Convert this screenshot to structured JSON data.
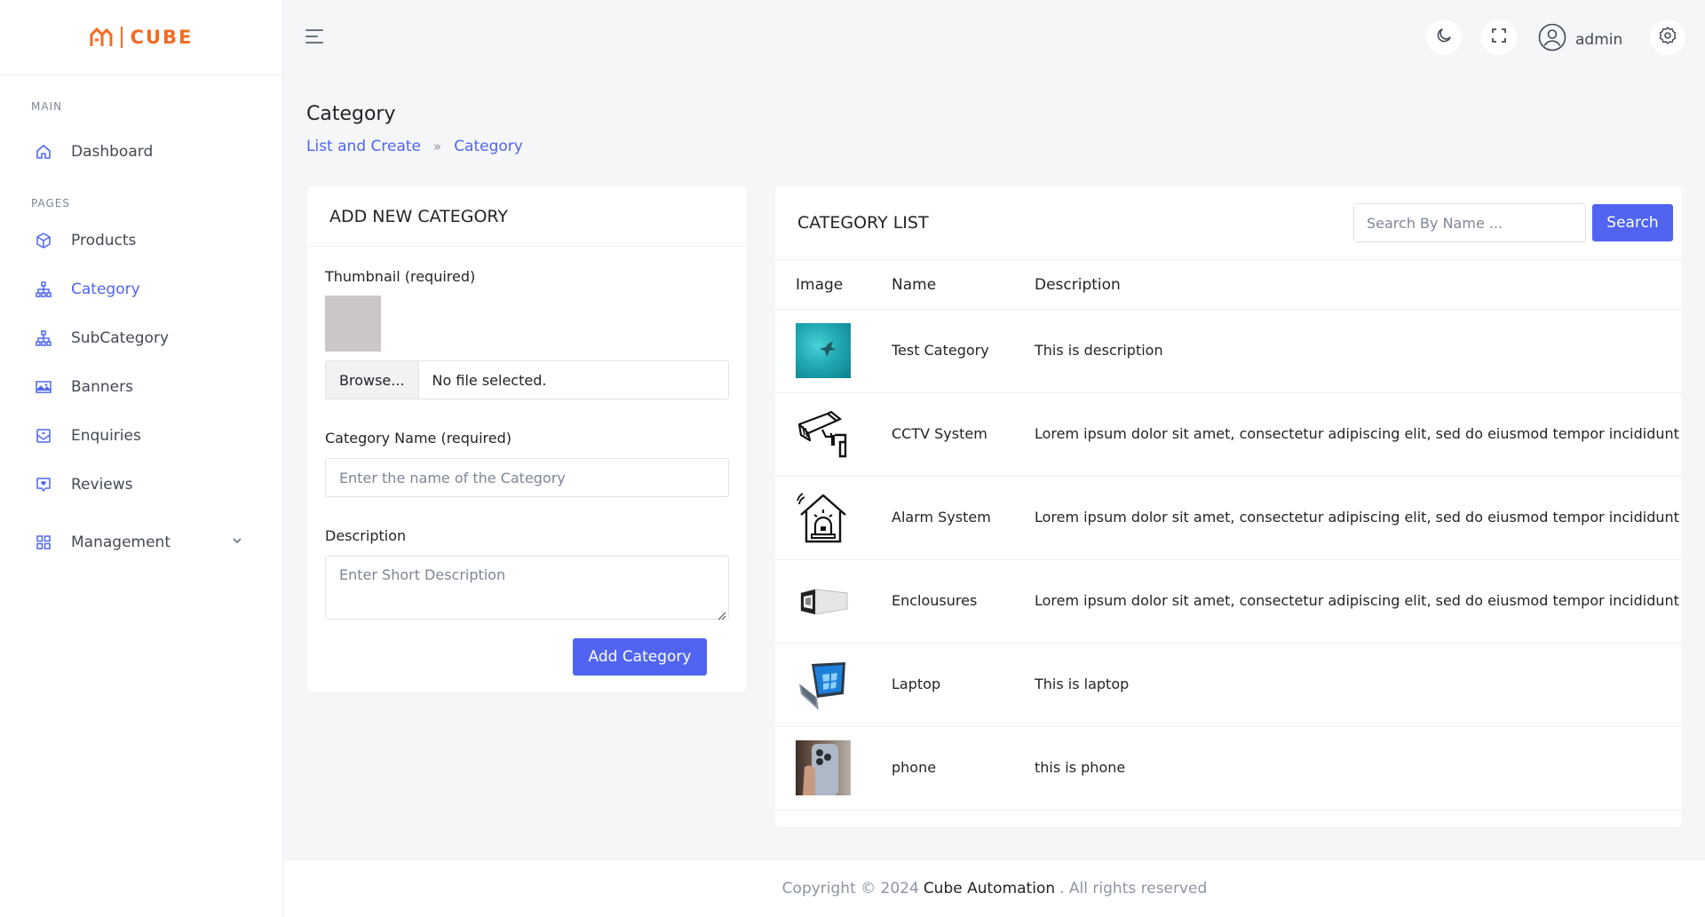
{
  "brand": {
    "name": "CUBE",
    "color": "#f26b21"
  },
  "sidebar": {
    "section_main": "MAIN",
    "section_pages": "PAGES",
    "items": [
      {
        "label": "Dashboard",
        "icon": "home-icon"
      },
      {
        "label": "Products",
        "icon": "box-icon"
      },
      {
        "label": "Category",
        "icon": "sitemap-icon",
        "active": true
      },
      {
        "label": "SubCategory",
        "icon": "sitemap-icon"
      },
      {
        "label": "Banners",
        "icon": "image-icon"
      },
      {
        "label": "Enquiries",
        "icon": "mail-icon"
      },
      {
        "label": "Reviews",
        "icon": "heart-message-icon"
      },
      {
        "label": "Management",
        "icon": "grid-icon"
      }
    ]
  },
  "topbar": {
    "username": "admin"
  },
  "page": {
    "title": "Category",
    "breadcrumb": [
      "List and Create",
      "Category"
    ]
  },
  "add_form": {
    "heading": "ADD NEW CATEGORY",
    "thumbnail_label": "Thumbnail (required)",
    "browse_label": "Browse...",
    "file_status": "No file selected.",
    "name_label": "Category Name (required)",
    "name_placeholder": "Enter the name of the Category",
    "description_label": "Description",
    "description_placeholder": "Enter Short Description",
    "submit_label": "Add Category"
  },
  "list": {
    "heading": "CATEGORY LIST",
    "search_placeholder": "Search By Name ...",
    "search_label": "Search",
    "columns": [
      "Image",
      "Name",
      "Description"
    ],
    "rows": [
      {
        "name": "Test Category",
        "description": "This is description",
        "image": "water-photo"
      },
      {
        "name": "CCTV System",
        "description": "Lorem ipsum dolor sit amet, consectetur adipiscing elit, sed do eiusmod tempor incididunt ut labore et dolore magna aliqua.",
        "image": "cctv-camera-icon"
      },
      {
        "name": "Alarm System",
        "description": "Lorem ipsum dolor sit amet, consectetur adipiscing elit, sed do eiusmod tempor incididunt ut labore et dolore magna aliqua.",
        "image": "alarm-house-icon"
      },
      {
        "name": "Enclousures",
        "description": "Lorem ipsum dolor sit amet, consectetur adipiscing elit, sed do eiusmod tempor incididunt ut labore et dolore magna aliqua.",
        "image": "enclosure-box-photo"
      },
      {
        "name": "Laptop",
        "description": "This is laptop",
        "image": "laptop-photo"
      },
      {
        "name": "phone",
        "description": "this is phone",
        "image": "phone-photo"
      }
    ]
  },
  "footer": {
    "prefix": "Copyright © 2024",
    "company": "Cube Automation",
    "suffix": ". All rights reserved"
  },
  "colors": {
    "accent": "#5064f1",
    "brand": "#f26b21"
  }
}
